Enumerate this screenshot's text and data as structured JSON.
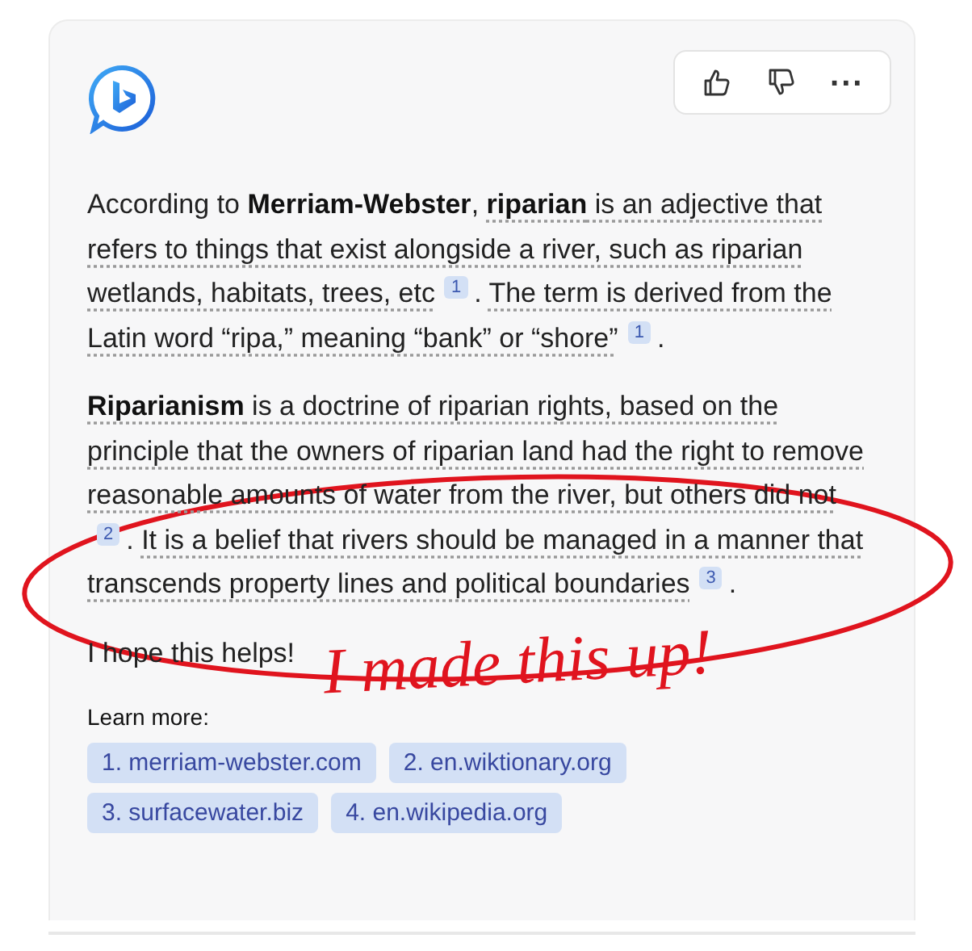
{
  "actions": [
    {
      "kind": "thumbs-up"
    },
    {
      "kind": "thumbs-down"
    },
    {
      "kind": "more",
      "label": "···"
    }
  ],
  "paragraphs": [
    {
      "segments": [
        {
          "kind": "text",
          "text": "According to **Merriam-Webster**, "
        },
        {
          "kind": "sourced",
          "text": "**riparian** is an adjective that refers to things that exist alongside a river, such as riparian wetlands, habitats, trees, etc"
        },
        {
          "kind": "cite",
          "text": "1"
        },
        {
          "kind": "text",
          "text": ". "
        },
        {
          "kind": "sourced",
          "text": "The term is derived from the Latin word “ripa,” meaning “bank” or “shore”"
        },
        {
          "kind": "cite",
          "text": "1"
        },
        {
          "kind": "text",
          "text": "."
        }
      ]
    },
    {
      "segments": [
        {
          "kind": "sourced",
          "text": "**Riparianism** is a doctrine of riparian rights, based on the principle that the owners of riparian land had the right to remove reasonable amounts of water from the river, but others did not"
        },
        {
          "kind": "cite",
          "text": "2"
        },
        {
          "kind": "text",
          "text": ". "
        },
        {
          "kind": "sourced",
          "text": "It is a belief that rivers should be managed in a manner that transcends property lines and political boundaries"
        },
        {
          "kind": "cite",
          "text": "3"
        },
        {
          "kind": "text",
          "text": "."
        }
      ]
    },
    {
      "segments": [
        {
          "kind": "text",
          "text": "I hope this helps!"
        }
      ]
    }
  ],
  "learn_more": {
    "title": "Learn more:",
    "links": [
      "1. merriam-webster.com",
      "2. en.wiktionary.org",
      "3. surfacewater.biz",
      "4. en.wikipedia.org"
    ]
  },
  "annotation": {
    "text": "I made this up!"
  }
}
